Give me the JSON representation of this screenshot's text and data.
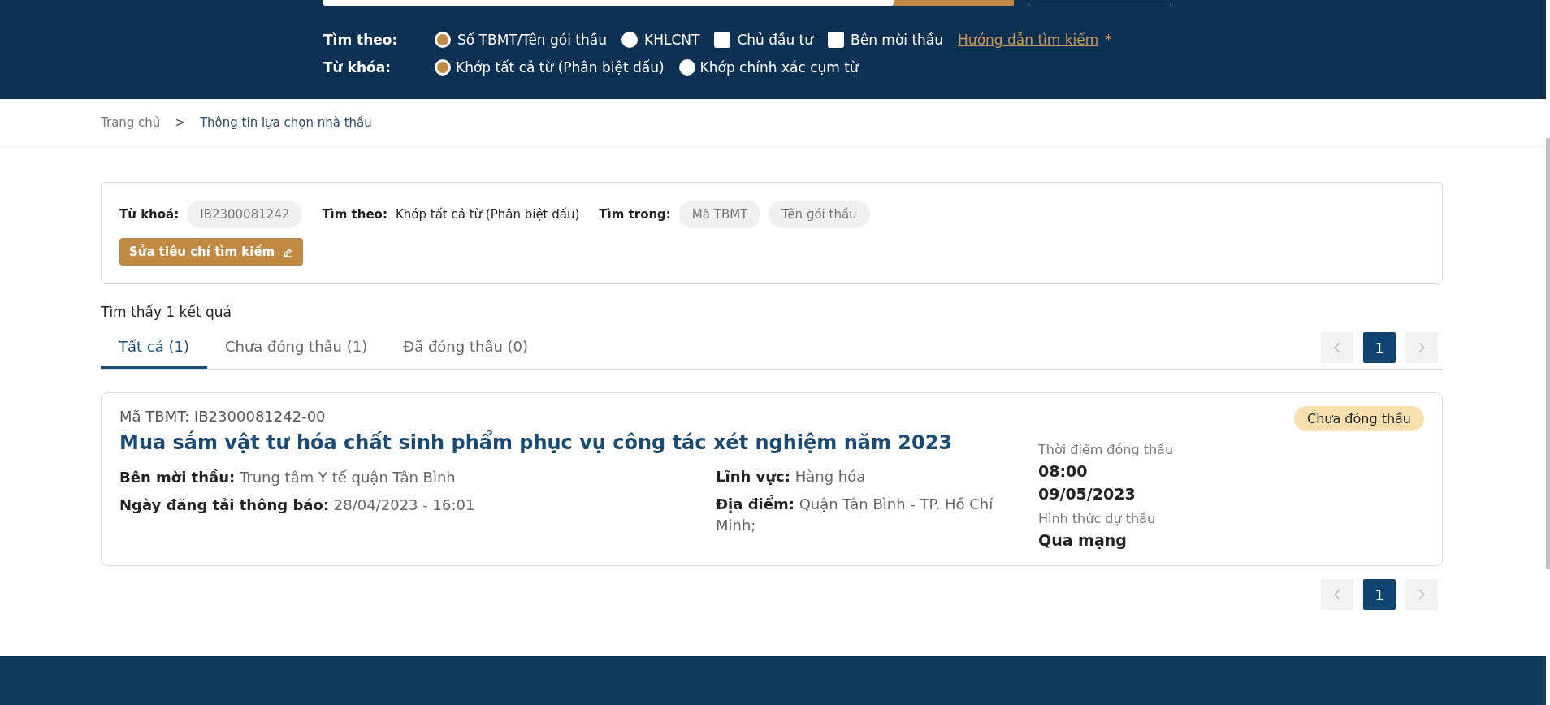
{
  "header": {
    "search_by": {
      "label": "Tìm theo:",
      "options": [
        {
          "kind": "radio",
          "label": "Số TBMT/Tên gói thầu",
          "selected": true
        },
        {
          "kind": "radio",
          "label": "KHLCNT",
          "selected": false
        },
        {
          "kind": "checkbox",
          "label": "Chủ đầu tư",
          "checked": false
        },
        {
          "kind": "checkbox",
          "label": "Bên mời thầu",
          "checked": false
        }
      ],
      "help_link": "Hướng dẫn tìm kiếm",
      "help_mark": "*"
    },
    "keyword_mode": {
      "label": "Từ khóa:",
      "options": [
        {
          "label": "Khớp tất cả từ (Phân biệt dấu)",
          "selected": true
        },
        {
          "label": "Khớp chính xác cụm từ",
          "selected": false
        }
      ]
    }
  },
  "breadcrumb": [
    "Trang chủ",
    "Thông tin lựa chọn nhà thầu"
  ],
  "breadcrumb_separator": ">",
  "criteria": {
    "keyword_label": "Từ khoá:",
    "keyword": "IB2300081242",
    "search_by_label": "Tìm theo:",
    "search_by": "Khớp tất cả từ (Phân biệt dấu)",
    "search_in_label": "Tìm trong:",
    "search_in": [
      "Mã TBMT",
      "Tên gói thầu"
    ],
    "edit_button": "Sửa tiêu chí tìm kiếm"
  },
  "result_count": "Tìm thấy 1 kết quả",
  "tabs": [
    {
      "label": "Tất cả (1)",
      "selected": true
    },
    {
      "label": "Chưa đóng thầu (1)",
      "selected": false
    },
    {
      "label": "Đã đóng thầu (0)",
      "selected": false
    }
  ],
  "pagination_top": [
    {
      "label": "1",
      "selected": true
    }
  ],
  "results": [
    {
      "code": "Mã TBMT: IB2300081242-00",
      "title": "Mua sắm vật tư hóa chất sinh phẩm phục vụ công tác xét nghiệm năm 2023",
      "status": "Chưa đóng thầu",
      "fields_left": [
        {
          "label": "Bên mời thầu:",
          "value": "Trung tâm Y tế quận Tân Bình"
        },
        {
          "label": "Ngày đăng tải thông báo:",
          "value": "28/04/2023 - 16:01"
        }
      ],
      "fields_middle": [
        {
          "label": "Lĩnh vực:",
          "value": "Hàng hóa"
        },
        {
          "label": "Địa điểm:",
          "value": "Quận Tân Bình - TP. Hồ Chí Minh;"
        }
      ],
      "closing_label": "Thời điểm đóng thầu",
      "closing_time": "08:00",
      "closing_date": "09/05/2023",
      "method_label": "Hình thức dự thầu",
      "method": "Qua mạng"
    }
  ],
  "pagination_bottom": [
    {
      "label": "1",
      "selected": true
    }
  ]
}
